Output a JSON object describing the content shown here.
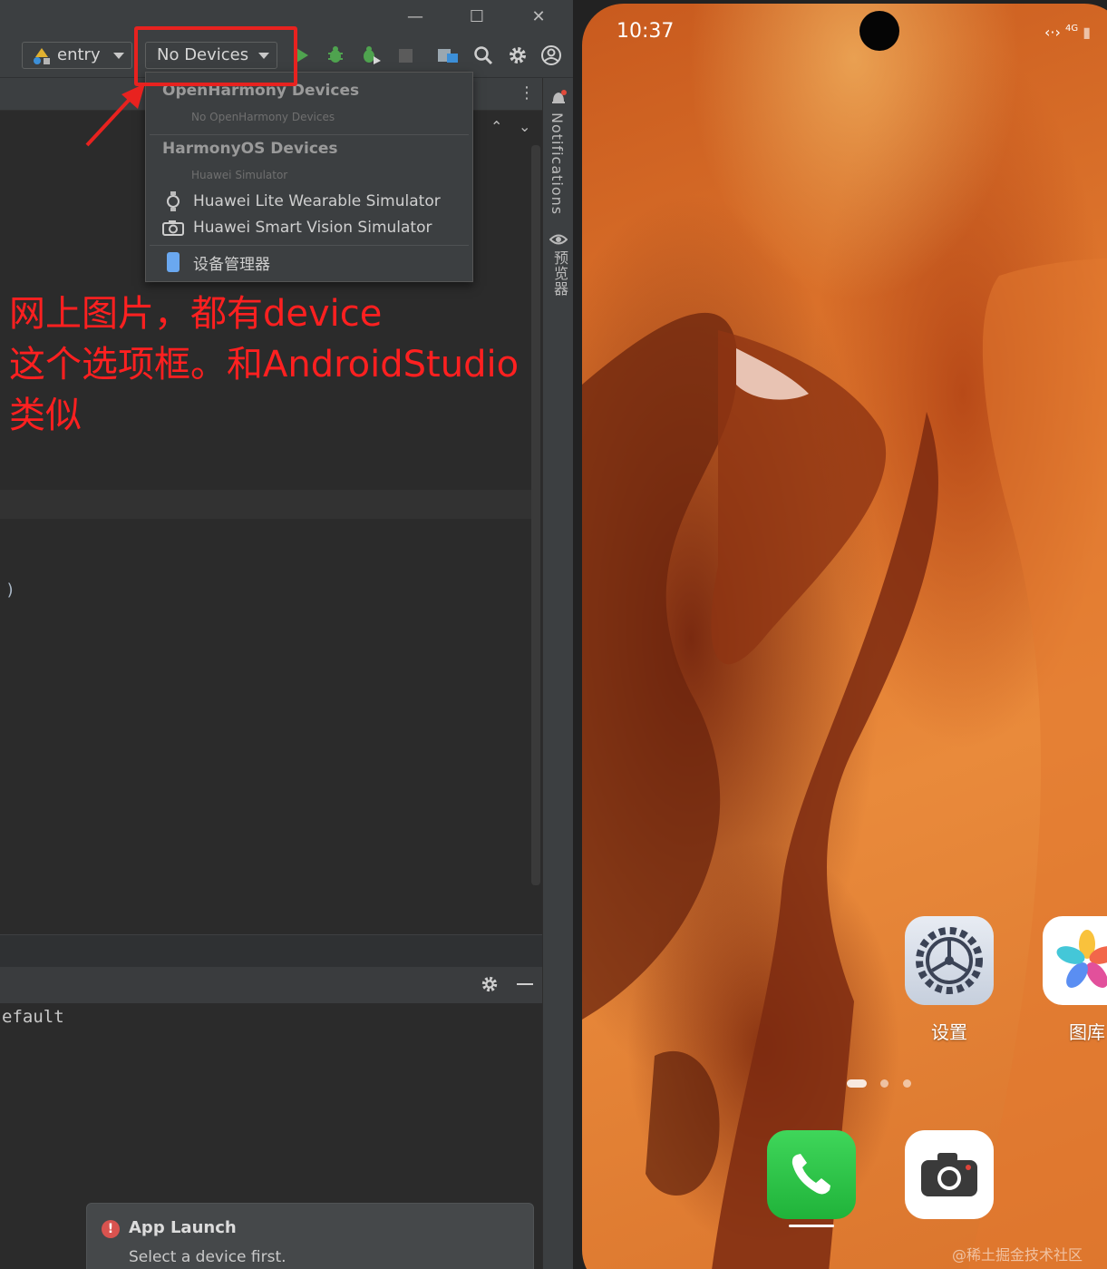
{
  "toolbar": {
    "module_label": "entry",
    "device_selector_label": "No Devices"
  },
  "device_menu": {
    "openharmony_group": "OpenHarmony Devices",
    "openharmony_empty": "No OpenHarmony Devices",
    "harmonyos_group": "HarmonyOS Devices",
    "harmonyos_sub": "Huawei Simulator",
    "items": [
      {
        "label": "Huawei Lite Wearable Simulator",
        "icon": "watch-icon"
      },
      {
        "label": "Huawei Smart Vision Simulator",
        "icon": "camera-icon"
      }
    ],
    "device_manager": "设备管理器"
  },
  "side_tools": {
    "notifications": "Notifications",
    "previewer": "预览器"
  },
  "editor": {
    "partial_line": ")"
  },
  "run_panel": {
    "partial_text": "efault"
  },
  "toast": {
    "title": "App Launch",
    "message": "Select a device first."
  },
  "annotation": {
    "lines": [
      "网上图片，都有device",
      "这个选项框。和AndroidStudio",
      "类似"
    ],
    "color": "#ff2020"
  },
  "phone": {
    "time": "10:37",
    "network": "4G",
    "apps": [
      {
        "label": "设置",
        "icon": "settings-icon"
      },
      {
        "label": "图库",
        "icon": "gallery-icon"
      }
    ],
    "dock": [
      {
        "icon": "phone-icon"
      },
      {
        "icon": "camera-icon"
      }
    ]
  },
  "watermark": "@稀土掘金技术社区"
}
